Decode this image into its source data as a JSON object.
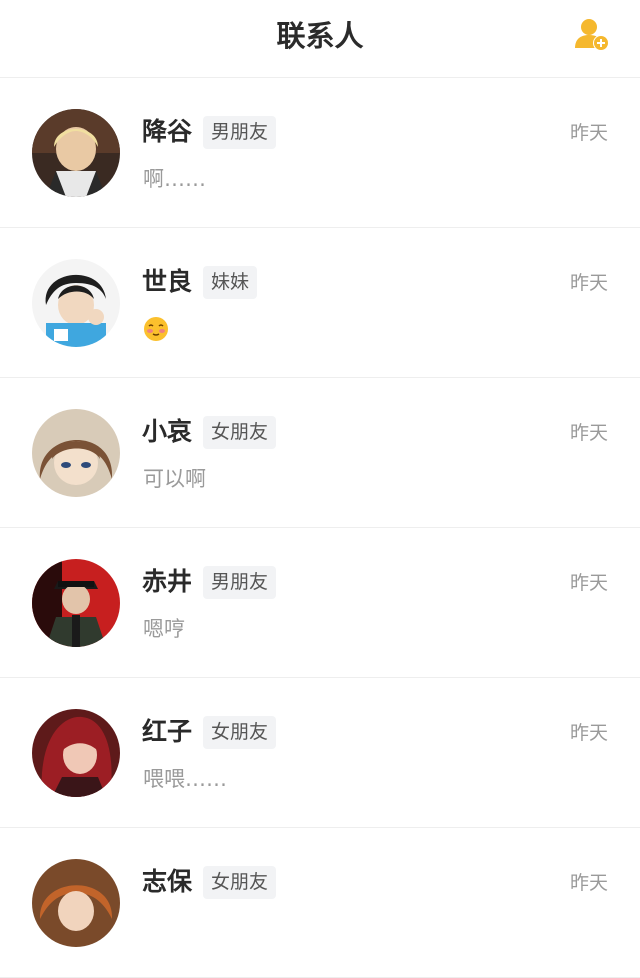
{
  "header": {
    "title": "联系人",
    "add_icon": "add-contact-icon"
  },
  "colors": {
    "accent": "#f5b82e",
    "tag_bg": "#f2f3f5",
    "muted_text": "#9a9a9a",
    "divider": "#eeeeee"
  },
  "contacts": [
    {
      "name": "降谷",
      "tag": "男朋友",
      "message": "啊……",
      "time": "昨天"
    },
    {
      "name": "世良",
      "tag": "妹妹",
      "message": "",
      "message_icon": "blushing-emoji-icon",
      "time": "昨天"
    },
    {
      "name": "小哀",
      "tag": "女朋友",
      "message": "可以啊",
      "time": "昨天"
    },
    {
      "name": "赤井",
      "tag": "男朋友",
      "message": "嗯哼",
      "time": "昨天"
    },
    {
      "name": "红子",
      "tag": "女朋友",
      "message": "喂喂……",
      "time": "昨天"
    },
    {
      "name": "志保",
      "tag": "女朋友",
      "message": "",
      "time": "昨天"
    }
  ]
}
